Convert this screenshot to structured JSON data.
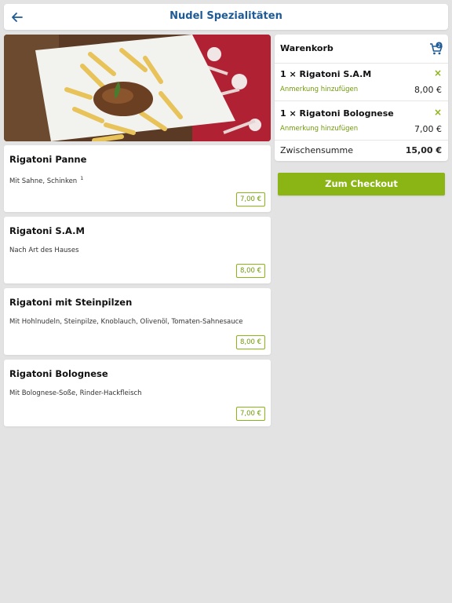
{
  "header": {
    "title": "Nudel Spezialitäten"
  },
  "menu_items": [
    {
      "name": "Rigatoni Panne",
      "description": "Mit Sahne, Schinken",
      "footnote": "1",
      "price": "7,00 €"
    },
    {
      "name": "Rigatoni S.A.M",
      "description": "Nach Art des Hauses",
      "footnote": "",
      "price": "8,00 €"
    },
    {
      "name": "Rigatoni mit Steinpilzen",
      "description": "Mit Hohlnudeln, Steinpilze, Knoblauch, Olivenöl, Tomaten-Sahnesauce",
      "footnote": "",
      "price": "8,00 €"
    },
    {
      "name": "Rigatoni Bolognese",
      "description": "Mit Bolognese-Soße, Rinder-Hackfleisch",
      "footnote": "",
      "price": "7,00 €"
    }
  ],
  "cart": {
    "title": "Warenkorb",
    "badge_count": "2",
    "items": [
      {
        "label": "1 × Rigatoni S.A.M",
        "note_link": "Anmerkung hinzufügen",
        "price": "8,00 €",
        "remove_symbol": "×"
      },
      {
        "label": "1 × Rigatoni Bolognese",
        "note_link": "Anmerkung hinzufügen",
        "price": "7,00 €",
        "remove_symbol": "×"
      }
    ],
    "subtotal_label": "Zwischensumme",
    "subtotal_value": "15,00 €",
    "checkout_label": "Zum Checkout"
  },
  "icons": {
    "back": "arrow-left-icon",
    "cart": "shopping-cart-icon",
    "remove": "close-icon"
  },
  "colors": {
    "accent_green": "#8ab514",
    "title_blue": "#1e5a96",
    "background": "#e3e3e3"
  }
}
